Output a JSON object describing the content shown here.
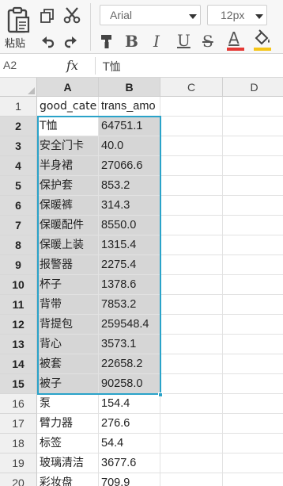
{
  "toolbar": {
    "paste_label": "粘贴",
    "font_name": "Arial",
    "font_size": "12px",
    "bold": "B",
    "italic": "I",
    "underline": "U",
    "strike": "S",
    "font_color_letter": "A",
    "colors": {
      "accent": "#2aa3c9",
      "font_color_bar": "#e53935",
      "fill_color_bar": "#f5c518"
    }
  },
  "formula_bar": {
    "cell_ref": "A2",
    "fx": "fx",
    "content": "T恤"
  },
  "grid": {
    "columns": [
      "A",
      "B",
      "C",
      "D"
    ],
    "selected_columns": [
      "A",
      "B"
    ],
    "rows": [
      {
        "num": "1",
        "a": "good_cate",
        "b": "trans_amo"
      },
      {
        "num": "2",
        "a": "T恤",
        "b": "64751.1"
      },
      {
        "num": "3",
        "a": "安全门卡",
        "b": "40.0"
      },
      {
        "num": "4",
        "a": "半身裙",
        "b": "27066.6"
      },
      {
        "num": "5",
        "a": "保护套",
        "b": "853.2"
      },
      {
        "num": "6",
        "a": "保暖裤",
        "b": "314.3"
      },
      {
        "num": "7",
        "a": "保暖配件",
        "b": "8550.0"
      },
      {
        "num": "8",
        "a": "保暖上装",
        "b": "1315.4"
      },
      {
        "num": "9",
        "a": "报警器",
        "b": "2275.4"
      },
      {
        "num": "10",
        "a": "杯子",
        "b": "1378.6"
      },
      {
        "num": "11",
        "a": "背带",
        "b": "7853.2"
      },
      {
        "num": "12",
        "a": "背提包",
        "b": "259548.4"
      },
      {
        "num": "13",
        "a": "背心",
        "b": "3573.1"
      },
      {
        "num": "14",
        "a": "被套",
        "b": "22658.2"
      },
      {
        "num": "15",
        "a": "被子",
        "b": "90258.0"
      },
      {
        "num": "16",
        "a": "泵",
        "b": "154.4"
      },
      {
        "num": "17",
        "a": "臂力器",
        "b": "276.6"
      },
      {
        "num": "18",
        "a": "标签",
        "b": "54.4"
      },
      {
        "num": "19",
        "a": "玻璃清洁",
        "b": "3677.6"
      },
      {
        "num": "20",
        "a": "彩妆盘",
        "b": "709.9"
      }
    ]
  }
}
